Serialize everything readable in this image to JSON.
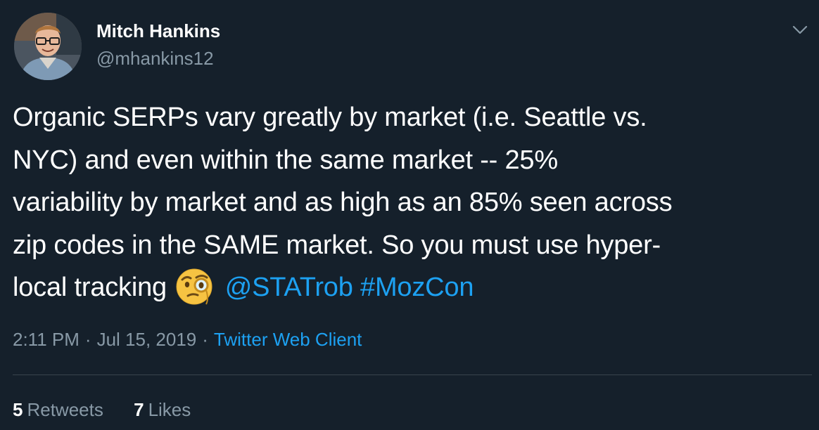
{
  "author": {
    "name": "Mitch Hankins",
    "handle": "@mhankins12"
  },
  "tweet": {
    "lines": [
      "Organic SERPs vary greatly by market (i.e. Seattle vs.",
      "NYC) and even within the same market -- 25%",
      "variability by market and as high as an 85% seen across",
      "zip codes in the SAME market. So you must use hyper-",
      "local tracking"
    ],
    "emoji": "face-with-monocle-emoji",
    "mention": "@STATrob",
    "hashtag": "#MozCon"
  },
  "meta": {
    "time": "2:11 PM",
    "separator1": "·",
    "date": "Jul 15, 2019",
    "separator2": "·",
    "client": "Twitter Web Client"
  },
  "stats": {
    "retweets_count": "5",
    "retweets_label": "Retweets",
    "likes_count": "7",
    "likes_label": "Likes"
  },
  "colors": {
    "background": "#15202b",
    "text": "#ffffff",
    "secondary": "#8899a6",
    "link": "#1da1f2",
    "divider": "#38444d"
  }
}
